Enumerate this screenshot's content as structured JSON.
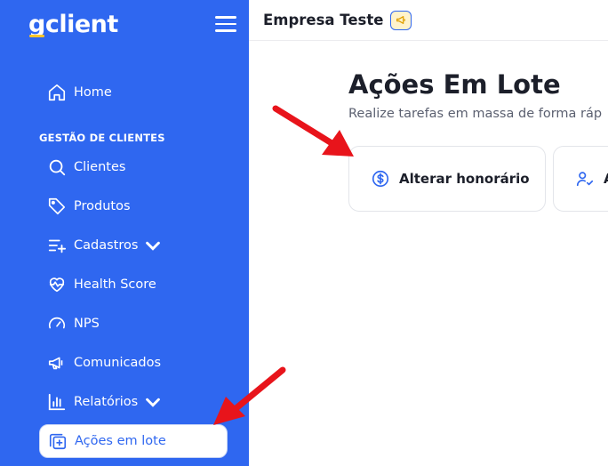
{
  "sidebar": {
    "logo": {
      "mark": "g",
      "text": "client"
    },
    "menu_icon": "hamburger-icon",
    "section_label": "GESTÃO DE CLIENTES",
    "items": [
      {
        "label": "Home",
        "icon": "home-icon"
      },
      {
        "label": "Clientes",
        "icon": "search-icon"
      },
      {
        "label": "Produtos",
        "icon": "tag-icon"
      },
      {
        "label": "Cadastros",
        "icon": "list-plus-icon",
        "has_chevron": true
      },
      {
        "label": "Health Score",
        "icon": "heart-pulse-icon"
      },
      {
        "label": "NPS",
        "icon": "gauge-icon"
      },
      {
        "label": "Comunicados",
        "icon": "megaphone-icon"
      },
      {
        "label": "Relatórios",
        "icon": "bar-chart-icon",
        "has_chevron": true
      },
      {
        "label": "Ações em lote",
        "icon": "copy-plus-icon",
        "active": true
      }
    ]
  },
  "header": {
    "company": "Empresa Teste",
    "badge_icon": "megaphone-icon"
  },
  "main": {
    "title": "Ações Em Lote",
    "subtitle": "Realize tarefas em massa de forma ráp",
    "cards": [
      {
        "label": "Alterar honorário",
        "icon": "dollar-circle-icon"
      },
      {
        "label": "A",
        "icon": "user-check-icon"
      }
    ]
  },
  "colors": {
    "sidebar_bg": "#2f67f0",
    "accent": "#2f67f0",
    "logo_underline": "#ffc62b",
    "annotation_arrow": "#e8141b"
  }
}
